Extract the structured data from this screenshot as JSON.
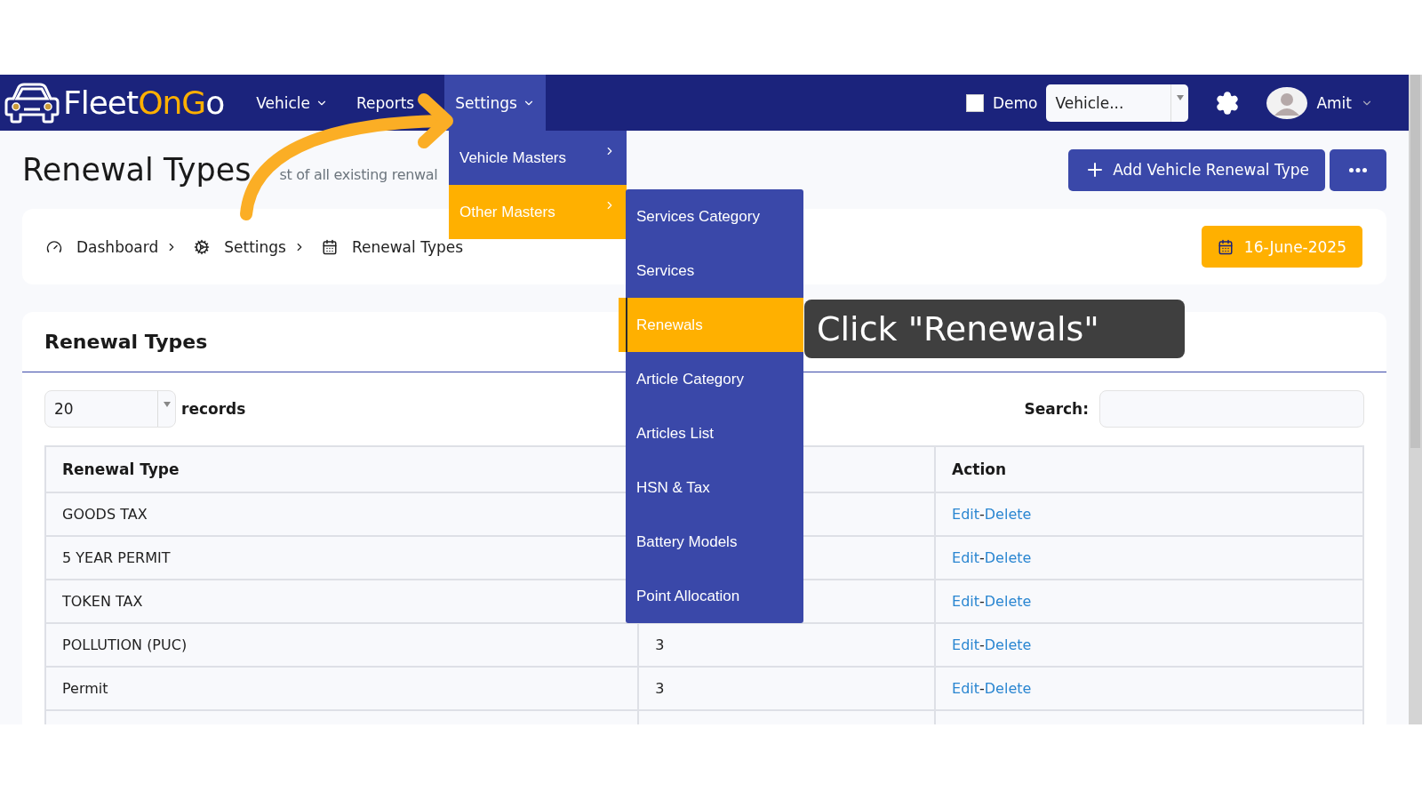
{
  "logo": {
    "parts": [
      {
        "text": "Fleet",
        "accent": false
      },
      {
        "text": "OnG",
        "accent": true
      },
      {
        "text": "o",
        "accent": false
      }
    ]
  },
  "nav": {
    "items": [
      {
        "label": "Vehicle",
        "has_caret": true,
        "selected": false
      },
      {
        "label": "Reports",
        "has_caret": false,
        "selected": false
      },
      {
        "label": "Settings",
        "has_caret": true,
        "selected": true
      }
    ],
    "demo": {
      "label": "Demo",
      "checked": false
    },
    "vehicle_select": {
      "value": "Vehicle..."
    },
    "user": {
      "name": "Amit"
    }
  },
  "settings_menu": {
    "items": [
      {
        "label": "Vehicle Masters",
        "selected": false
      },
      {
        "label": "Other Masters",
        "selected": true
      }
    ]
  },
  "other_masters_menu": {
    "items": [
      {
        "label": "Services Category",
        "selected": false
      },
      {
        "label": "Services",
        "selected": false
      },
      {
        "label": "Renewals",
        "selected": true
      },
      {
        "label": "Article Category",
        "selected": false
      },
      {
        "label": "Articles List",
        "selected": false
      },
      {
        "label": "HSN & Tax",
        "selected": false
      },
      {
        "label": "Battery Models",
        "selected": false
      },
      {
        "label": "Point Allocation",
        "selected": false
      }
    ]
  },
  "tooltip": {
    "text": "Click \"Renewals\""
  },
  "page": {
    "title": "Renewal Types",
    "subtitle": "st of all existing renwal"
  },
  "buttons": {
    "add": "Add Vehicle Renewal Type"
  },
  "breadcrumb": [
    {
      "label": "Dashboard"
    },
    {
      "label": "Settings"
    },
    {
      "label": "Renewal Types"
    }
  ],
  "date_button": {
    "label": "16-June-2025"
  },
  "card": {
    "title": "Renewal Types",
    "page_size": "20",
    "records_label": "records",
    "search_label": "Search:"
  },
  "table": {
    "columns": [
      "Renewal Type",
      "Action"
    ],
    "rows": [
      {
        "renewal_type": "GOODS TAX",
        "action": {
          "edit": "Edit",
          "separator": "-",
          "delete": "Delete"
        }
      },
      {
        "renewal_type": "5 YEAR PERMIT",
        "action": {
          "edit": "Edit",
          "separator": "-",
          "delete": "Delete"
        }
      },
      {
        "renewal_type": "TOKEN TAX",
        "action": {
          "edit": "Edit",
          "separator": "-",
          "delete": "Delete"
        }
      },
      {
        "renewal_type": "POLLUTION (PUC)",
        "column_2": "3",
        "action": {
          "edit": "Edit",
          "separator": "-",
          "delete": "Delete"
        }
      },
      {
        "renewal_type": "Permit",
        "column_2": "3",
        "action": {
          "edit": "Edit",
          "separator": "-",
          "delete": "Delete"
        }
      }
    ]
  }
}
